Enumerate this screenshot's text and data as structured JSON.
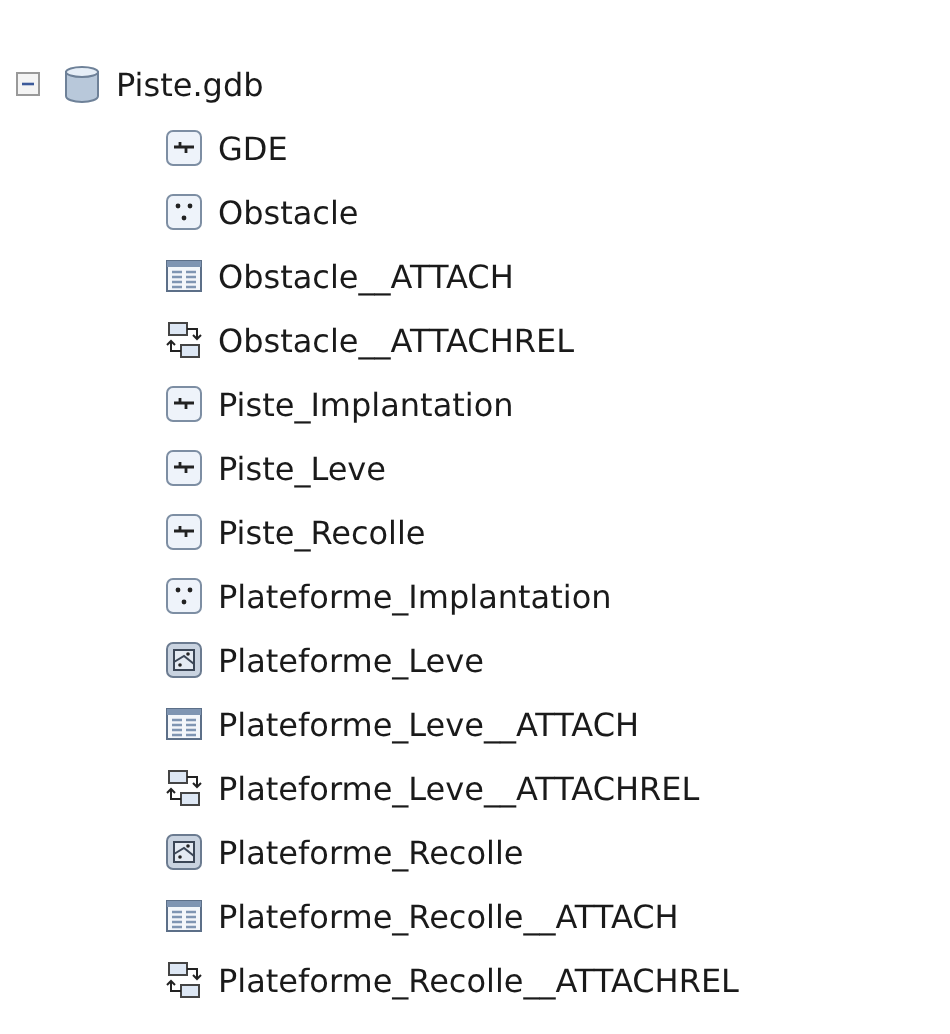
{
  "tree": {
    "label": "Piste.gdb",
    "kind": "database",
    "expanded": true,
    "children": [
      {
        "label": "GDE",
        "kind": "line"
      },
      {
        "label": "Obstacle",
        "kind": "point"
      },
      {
        "label": "Obstacle__ATTACH",
        "kind": "table"
      },
      {
        "label": "Obstacle__ATTACHREL",
        "kind": "relationship"
      },
      {
        "label": "Piste_Implantation",
        "kind": "line"
      },
      {
        "label": "Piste_Leve",
        "kind": "line"
      },
      {
        "label": "Piste_Recolle",
        "kind": "line"
      },
      {
        "label": "Plateforme_Implantation",
        "kind": "point"
      },
      {
        "label": "Plateforme_Leve",
        "kind": "polygon"
      },
      {
        "label": "Plateforme_Leve__ATTACH",
        "kind": "table"
      },
      {
        "label": "Plateforme_Leve__ATTACHREL",
        "kind": "relationship"
      },
      {
        "label": "Plateforme_Recolle",
        "kind": "polygon"
      },
      {
        "label": "Plateforme_Recolle__ATTACH",
        "kind": "table"
      },
      {
        "label": "Plateforme_Recolle__ATTACHREL",
        "kind": "relationship"
      }
    ]
  }
}
